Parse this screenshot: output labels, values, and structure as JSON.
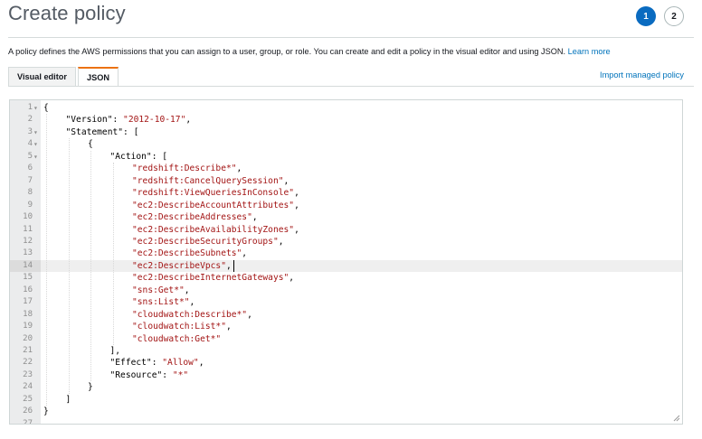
{
  "header": {
    "title": "Create policy",
    "steps": [
      "1",
      "2"
    ]
  },
  "description": {
    "text": "A policy defines the AWS permissions that you can assign to a user, group, or role. You can create and edit a policy in the visual editor and using JSON.",
    "learn_more": "Learn more"
  },
  "tabs": [
    {
      "label": "Visual editor",
      "active": false
    },
    {
      "label": "JSON",
      "active": true
    }
  ],
  "import_link": "Import managed policy",
  "editor": {
    "active_line": 14,
    "lines": [
      {
        "n": "1",
        "fold": true,
        "indent": 0,
        "parts": [
          [
            "p",
            "{"
          ]
        ]
      },
      {
        "n": "2",
        "fold": false,
        "indent": 1,
        "parts": [
          [
            "k",
            "\"Version\""
          ],
          [
            "p",
            ": "
          ],
          [
            "s",
            "\"2012-10-17\""
          ],
          [
            "p",
            ","
          ]
        ]
      },
      {
        "n": "3",
        "fold": true,
        "indent": 1,
        "parts": [
          [
            "k",
            "\"Statement\""
          ],
          [
            "p",
            ": ["
          ]
        ]
      },
      {
        "n": "4",
        "fold": true,
        "indent": 2,
        "parts": [
          [
            "p",
            "{"
          ]
        ]
      },
      {
        "n": "5",
        "fold": true,
        "indent": 3,
        "parts": [
          [
            "k",
            "\"Action\""
          ],
          [
            "p",
            ": ["
          ]
        ]
      },
      {
        "n": "6",
        "fold": false,
        "indent": 4,
        "parts": [
          [
            "s",
            "\"redshift:Describe*\""
          ],
          [
            "p",
            ","
          ]
        ]
      },
      {
        "n": "7",
        "fold": false,
        "indent": 4,
        "parts": [
          [
            "s",
            "\"redshift:CancelQuerySession\""
          ],
          [
            "p",
            ","
          ]
        ]
      },
      {
        "n": "8",
        "fold": false,
        "indent": 4,
        "parts": [
          [
            "s",
            "\"redshift:ViewQueriesInConsole\""
          ],
          [
            "p",
            ","
          ]
        ]
      },
      {
        "n": "9",
        "fold": false,
        "indent": 4,
        "parts": [
          [
            "s",
            "\"ec2:DescribeAccountAttributes\""
          ],
          [
            "p",
            ","
          ]
        ]
      },
      {
        "n": "10",
        "fold": false,
        "indent": 4,
        "parts": [
          [
            "s",
            "\"ec2:DescribeAddresses\""
          ],
          [
            "p",
            ","
          ]
        ]
      },
      {
        "n": "11",
        "fold": false,
        "indent": 4,
        "parts": [
          [
            "s",
            "\"ec2:DescribeAvailabilityZones\""
          ],
          [
            "p",
            ","
          ]
        ]
      },
      {
        "n": "12",
        "fold": false,
        "indent": 4,
        "parts": [
          [
            "s",
            "\"ec2:DescribeSecurityGroups\""
          ],
          [
            "p",
            ","
          ]
        ]
      },
      {
        "n": "13",
        "fold": false,
        "indent": 4,
        "parts": [
          [
            "s",
            "\"ec2:DescribeSubnets\""
          ],
          [
            "p",
            ","
          ]
        ]
      },
      {
        "n": "14",
        "fold": false,
        "indent": 4,
        "parts": [
          [
            "s",
            "\"ec2:DescribeVpcs\""
          ],
          [
            "p",
            ","
          ]
        ]
      },
      {
        "n": "15",
        "fold": false,
        "indent": 4,
        "parts": [
          [
            "s",
            "\"ec2:DescribeInternetGateways\""
          ],
          [
            "p",
            ","
          ]
        ]
      },
      {
        "n": "16",
        "fold": false,
        "indent": 4,
        "parts": [
          [
            "s",
            "\"sns:Get*\""
          ],
          [
            "p",
            ","
          ]
        ]
      },
      {
        "n": "17",
        "fold": false,
        "indent": 4,
        "parts": [
          [
            "s",
            "\"sns:List*\""
          ],
          [
            "p",
            ","
          ]
        ]
      },
      {
        "n": "18",
        "fold": false,
        "indent": 4,
        "parts": [
          [
            "s",
            "\"cloudwatch:Describe*\""
          ],
          [
            "p",
            ","
          ]
        ]
      },
      {
        "n": "19",
        "fold": false,
        "indent": 4,
        "parts": [
          [
            "s",
            "\"cloudwatch:List*\""
          ],
          [
            "p",
            ","
          ]
        ]
      },
      {
        "n": "20",
        "fold": false,
        "indent": 4,
        "parts": [
          [
            "s",
            "\"cloudwatch:Get*\""
          ]
        ]
      },
      {
        "n": "21",
        "fold": false,
        "indent": 3,
        "parts": [
          [
            "p",
            "],"
          ]
        ]
      },
      {
        "n": "22",
        "fold": false,
        "indent": 3,
        "parts": [
          [
            "k",
            "\"Effect\""
          ],
          [
            "p",
            ": "
          ],
          [
            "s",
            "\"Allow\""
          ],
          [
            "p",
            ","
          ]
        ]
      },
      {
        "n": "23",
        "fold": false,
        "indent": 3,
        "parts": [
          [
            "k",
            "\"Resource\""
          ],
          [
            "p",
            ": "
          ],
          [
            "s",
            "\"*\""
          ]
        ]
      },
      {
        "n": "24",
        "fold": false,
        "indent": 2,
        "parts": [
          [
            "p",
            "}"
          ]
        ]
      },
      {
        "n": "25",
        "fold": false,
        "indent": 1,
        "parts": [
          [
            "p",
            "]"
          ]
        ]
      },
      {
        "n": "26",
        "fold": false,
        "indent": 0,
        "parts": [
          [
            "p",
            "}"
          ]
        ]
      },
      {
        "n": "27",
        "fold": false,
        "indent": 0,
        "parts": []
      }
    ]
  },
  "colors": {
    "accent": "#0a6bc0",
    "tab_active_border": "#ec7211",
    "link": "#0073bb",
    "string": "#a31515"
  }
}
